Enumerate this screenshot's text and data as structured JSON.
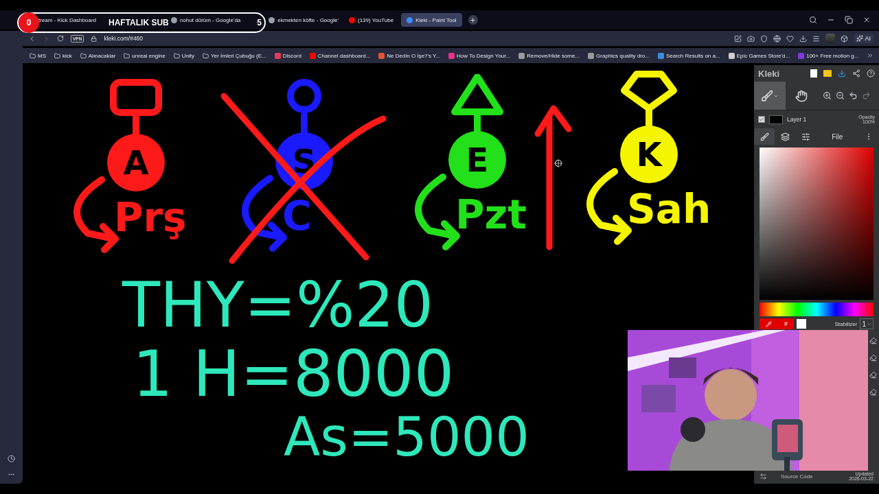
{
  "stream_overlay": {
    "count": "0",
    "title": "HAFTALIK SUB",
    "goal": "5"
  },
  "tabs": [
    {
      "label": "tream - Kick Dashboard",
      "selected": false
    },
    {
      "label": "nohut dürüm - Google'da",
      "selected": false,
      "color": "#9aa0a6"
    },
    {
      "label": "ekmekten köfte - Google'",
      "selected": false,
      "color": "#9aa0a6"
    },
    {
      "label": "(139) YouTube",
      "selected": false,
      "color": "#ff0000"
    },
    {
      "label": "Kleki - Paint Tool",
      "selected": true,
      "color": "#3d8bff"
    }
  ],
  "address": {
    "badge": "VPN",
    "url": "kleki.com/#460"
  },
  "ai_button": "AI",
  "bookmarks": [
    {
      "kind": "folder",
      "label": "MS"
    },
    {
      "kind": "folder",
      "label": "kick"
    },
    {
      "kind": "folder",
      "label": "Alınacaklar"
    },
    {
      "kind": "folder",
      "label": "unreal engine"
    },
    {
      "kind": "folder",
      "label": "Unity"
    },
    {
      "kind": "folder",
      "label": "Yer İmleri Çubuğu (E..."
    },
    {
      "kind": "link",
      "label": "Discord",
      "color": "#e03a5c"
    },
    {
      "kind": "link",
      "label": "Channel dashboard...",
      "color": "#ff0000"
    },
    {
      "kind": "link",
      "label": "Ne Dedin O İşe?'s Y...",
      "color": "#e0543a"
    },
    {
      "kind": "link",
      "label": "How To Design Your...",
      "color": "#e8308c"
    },
    {
      "kind": "link",
      "label": "Remove/Hide some...",
      "color": "#9a9a9a"
    },
    {
      "kind": "link",
      "label": "Graphics quality dro...",
      "color": "#9a9a9a"
    },
    {
      "kind": "link",
      "label": "Search Results on a...",
      "color": "#3a8ee0"
    },
    {
      "kind": "link",
      "label": "Epic Games Store'd...",
      "color": "#cfcfcf"
    },
    {
      "kind": "link",
      "label": "100+ Free motion g...",
      "color": "#7b3ae0"
    }
  ],
  "canvas": {
    "figures": [
      {
        "kind": "shield",
        "letter": "A",
        "label": "Prş",
        "color": "#ff1a1a",
        "crossed": false
      },
      {
        "kind": "circle",
        "letter": "S",
        "label": "C",
        "color": "#1a1aff",
        "crossed": true
      },
      {
        "kind": "triangle",
        "letter": "E",
        "label": "Pzt",
        "color": "#22e01a",
        "crossed": false
      },
      {
        "kind": "diamond",
        "letter": "K",
        "label": "Sah",
        "color": "#f5f500",
        "crossed": false
      }
    ],
    "notes": [
      "THY=%20",
      "1 H=8000",
      "As=5000"
    ]
  },
  "kleki": {
    "brand": "Kleki",
    "tools": [
      {
        "kind": "brush",
        "selected": true
      },
      {
        "kind": "hand",
        "selected": false
      }
    ],
    "layer": {
      "visible": true,
      "name": "Layer 1",
      "opacity_label": "Opacity",
      "opacity": "100%"
    },
    "tabs": [
      {
        "kind": "brush",
        "selected": true
      },
      {
        "kind": "layers",
        "selected": false
      },
      {
        "kind": "adjust",
        "selected": false
      },
      {
        "kind": "file",
        "label": "File",
        "selected": false
      }
    ],
    "hex_mark": "#",
    "stabilizer_label": "Stabilizer",
    "stabilizer": "1",
    "source_code": "Source Code",
    "updated_label": "Updated",
    "updated": "2026-03-22"
  }
}
